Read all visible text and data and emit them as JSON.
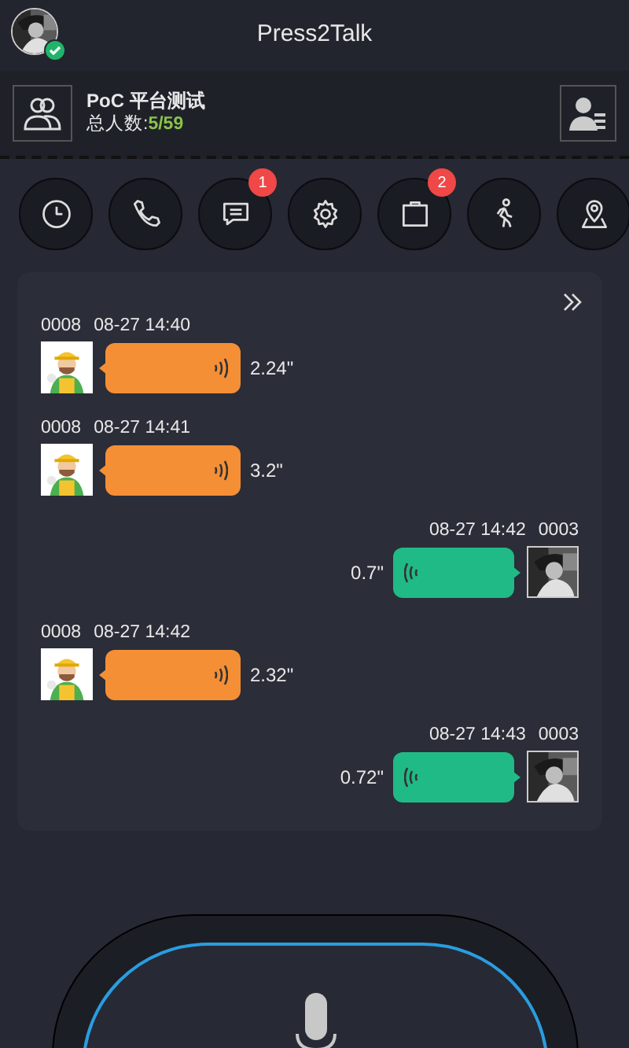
{
  "header": {
    "title": "Press2Talk",
    "user": {
      "online": true
    }
  },
  "group": {
    "name": "PoC 平台测试",
    "count_label": "总人数:",
    "count": "5/59"
  },
  "toolbar": [
    {
      "kind": "clock"
    },
    {
      "kind": "phone"
    },
    {
      "kind": "message",
      "badge": "1"
    },
    {
      "kind": "gear"
    },
    {
      "kind": "clipboard",
      "badge": "2"
    },
    {
      "kind": "walk"
    },
    {
      "kind": "location"
    }
  ],
  "messages": [
    {
      "kind": "incoming",
      "sender": "0008",
      "time": "08-27 14:40",
      "duration": "2.24\""
    },
    {
      "kind": "incoming",
      "sender": "0008",
      "time": "08-27 14:41",
      "duration": "3.2\""
    },
    {
      "kind": "outgoing",
      "sender": "0003",
      "time": "08-27 14:42",
      "duration": "0.7\""
    },
    {
      "kind": "incoming",
      "sender": "0008",
      "time": "08-27 14:42",
      "duration": "2.32\""
    },
    {
      "kind": "outgoing",
      "sender": "0003",
      "time": "08-27 14:43",
      "duration": "0.72\""
    }
  ]
}
